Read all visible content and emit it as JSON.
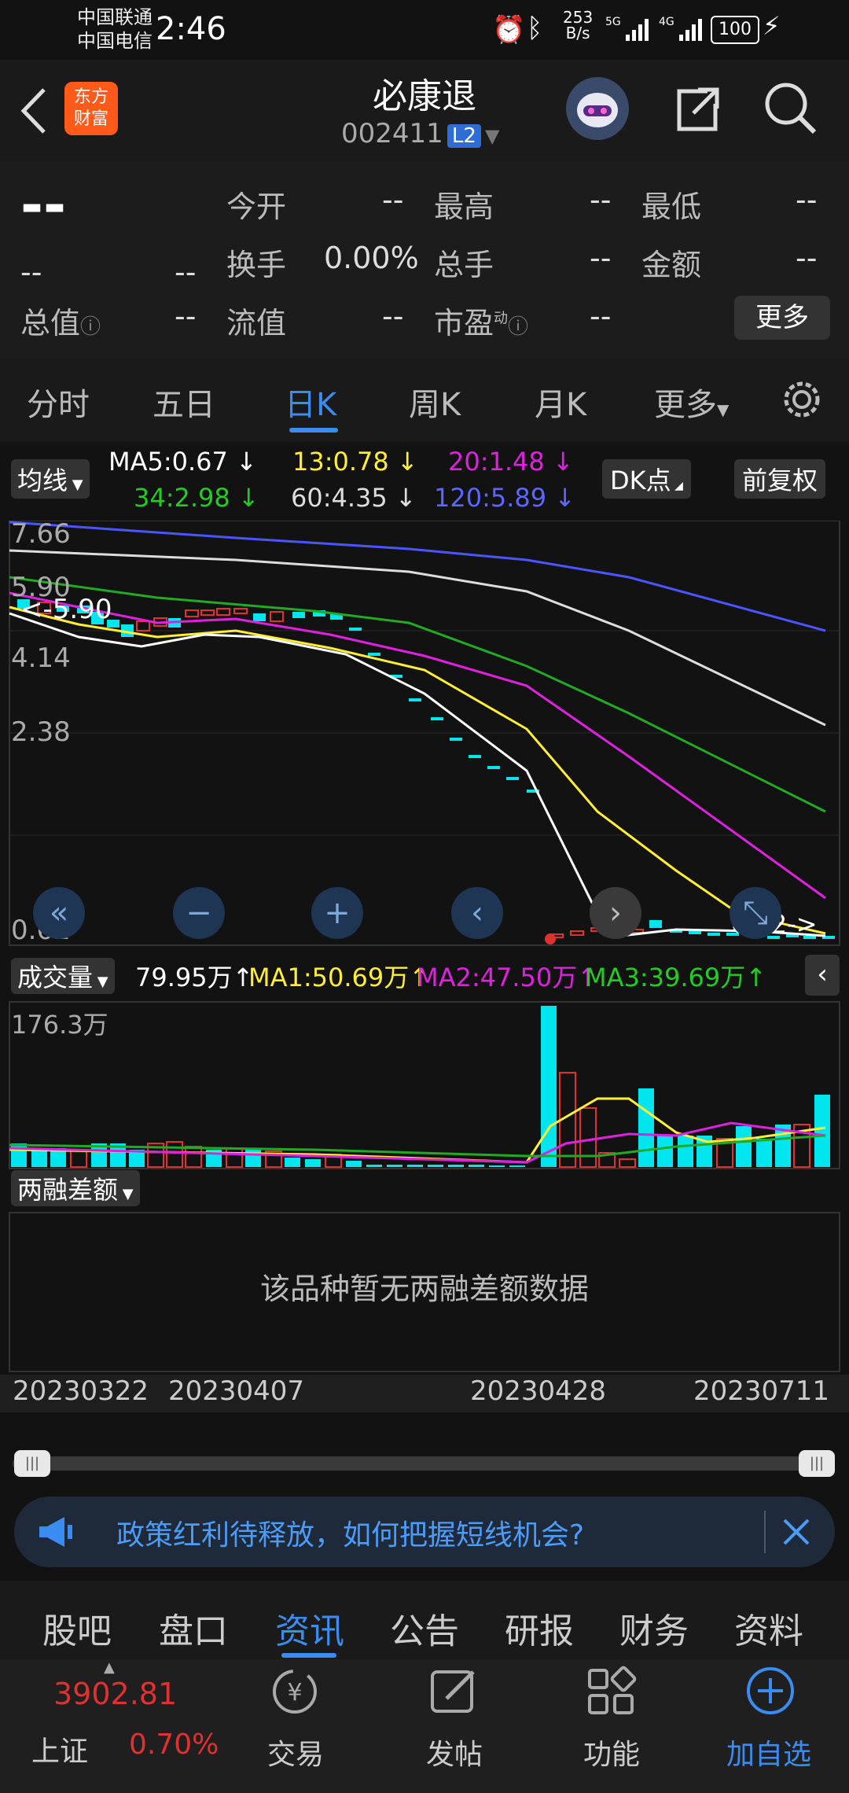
{
  "status": {
    "carrier1": "中国联通",
    "carrier2": "中国电信",
    "time": "2:46",
    "speed_top": "253",
    "speed_bottom": "B/s",
    "battery": "100"
  },
  "header": {
    "stock_name": "必康退",
    "stock_code": "002411",
    "level_badge": "L2",
    "logo_line1": "东方",
    "logo_line2": "财富"
  },
  "quote": {
    "price": "--",
    "change": "--",
    "change_pct": "--",
    "open_label": "今开",
    "open_value": "--",
    "high_label": "最高",
    "high_value": "--",
    "low_label": "最低",
    "low_value": "--",
    "turnover_label": "换手",
    "turnover_value": "0.00%",
    "total_vol_label": "总手",
    "total_vol_value": "--",
    "amount_label": "金额",
    "amount_value": "--",
    "mktcap_label": "总值",
    "mktcap_value": "--",
    "float_label": "流值",
    "float_value": "--",
    "pe_label": "市盈",
    "pe_sup": "动",
    "pe_value": "--",
    "more_button": "更多"
  },
  "tabs": [
    {
      "label": "分时"
    },
    {
      "label": "五日"
    },
    {
      "label": "日K"
    },
    {
      "label": "周K"
    },
    {
      "label": "月K"
    },
    {
      "label": "更多"
    }
  ],
  "ma_bar": {
    "selector": "均线",
    "ma5": "MA5:0.67",
    "ma13": "13:0.78",
    "ma20": "20:1.48",
    "ma34": "34:2.98",
    "ma60": "60:4.35",
    "ma120": "120:5.89",
    "dk": "DK点",
    "adjust": "前复权"
  },
  "chart_data": {
    "type": "candlestick",
    "y_ticks": [
      "7.66",
      "5.90",
      "4.14",
      "2.38",
      "0.62"
    ],
    "annotations": {
      "high_marker": "<-5.90",
      "low_marker": "0.62->"
    },
    "x_ticks": [
      "20230322",
      "20230407",
      "20230428",
      "20230711"
    ],
    "volume": {
      "selector": "成交量",
      "vol": "79.95万",
      "ma1": "MA1:50.69万",
      "ma2": "MA2:47.50万",
      "ma3": "MA3:39.69万",
      "max_label": "176.3万"
    },
    "margin": {
      "selector": "两融差额",
      "empty_text": "该品种暂无两融差额数据"
    }
  },
  "colors": {
    "ma5": "#ffffff",
    "ma13": "#ffee33",
    "ma20": "#e020e0",
    "ma34": "#22aa22",
    "ma60": "#dddddd",
    "ma120": "#4a55ff",
    "up": "#e03030",
    "down": "#00e5ee",
    "accent": "#3a8cf0"
  },
  "banner": {
    "text": "政策红利待释放，如何把握短线机会?"
  },
  "bottom_tabs": [
    {
      "label": "股吧"
    },
    {
      "label": "盘口"
    },
    {
      "label": "资讯"
    },
    {
      "label": "公告"
    },
    {
      "label": "研报"
    },
    {
      "label": "财务"
    },
    {
      "label": "资料"
    }
  ],
  "bottom_nav": {
    "index_value": "3902.81",
    "index_name": "上证",
    "index_pct": "0.70%",
    "trade": "交易",
    "post": "发帖",
    "function": "功能",
    "add_watch": "加自选"
  }
}
